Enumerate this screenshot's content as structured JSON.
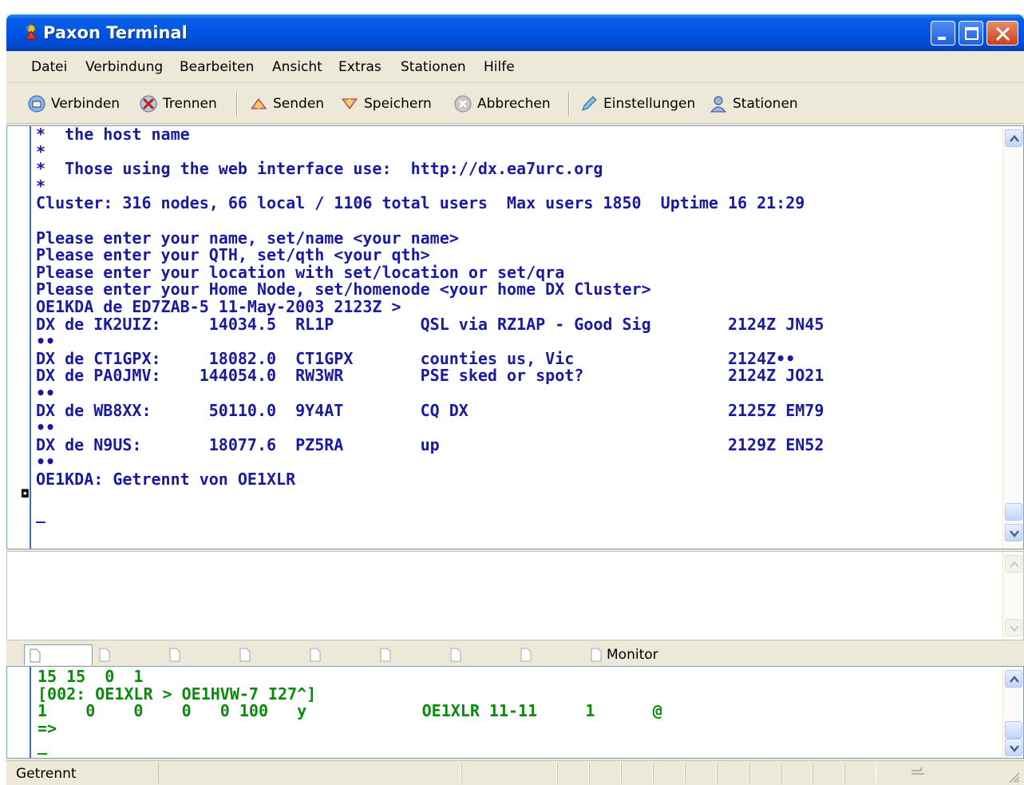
{
  "window": {
    "title": "Paxon Terminal",
    "accent": "#0055e5"
  },
  "menu": {
    "items": [
      "Datei",
      "Verbindung",
      "Bearbeiten",
      "Ansicht",
      "Extras",
      "Stationen",
      "Hilfe"
    ]
  },
  "toolbar": {
    "connect": "Verbinden",
    "disconnect": "Trennen",
    "send": "Senden",
    "save": "Speichern",
    "abort": "Abbrechen",
    "settings": "Einstellungen",
    "stations": "Stationen"
  },
  "terminal": {
    "lines": [
      "*  the host name",
      "*",
      "*  Those using the web interface use:  http://dx.ea7urc.org",
      "*",
      "Cluster: 316 nodes, 66 local / 1106 total users  Max users 1850  Uptime 16 21:29",
      "",
      "Please enter your name, set/name <your name>",
      "Please enter your QTH, set/qth <your qth>",
      "Please enter your location with set/location or set/qra",
      "Please enter your Home Node, set/homenode <your home DX Cluster>",
      "OE1KDA de ED7ZAB-5 11-May-2003 2123Z >",
      "DX de IK2UIZ:     14034.5  RL1P         QSL via RZ1AP - Good Sig        2124Z JN45",
      "••",
      "DX de CT1GPX:     18082.0  CT1GPX       counties us, Vic                2124Z••",
      "DX de PA0JMV:    144054.0  RW3WR        PSE sked or spot?               2124Z JO21",
      "••",
      "DX de WB8XX:      50110.0  9Y4AT        CQ DX                           2125Z EM79",
      "••",
      "DX de N9US:       18077.6  PZ5RA        up                              2129Z EN52",
      "••",
      "OE1KDA: Getrennt von OE1XLR",
      "",
      "_"
    ],
    "color": "#1a1aa0"
  },
  "tabs": {
    "items": [
      "",
      "",
      "",
      "",
      "",
      "",
      "",
      "",
      "Monitor"
    ]
  },
  "monitor": {
    "lines": [
      "15 15  0  1",
      "[002: OE1XLR > OE1HVW-7 I27^]",
      "1    0    0    0   0 100   y            OE1XLR 11-11     1      @",
      "=>",
      "_"
    ],
    "color": "#0a8a0a"
  },
  "status": {
    "text": "Getrennt"
  }
}
